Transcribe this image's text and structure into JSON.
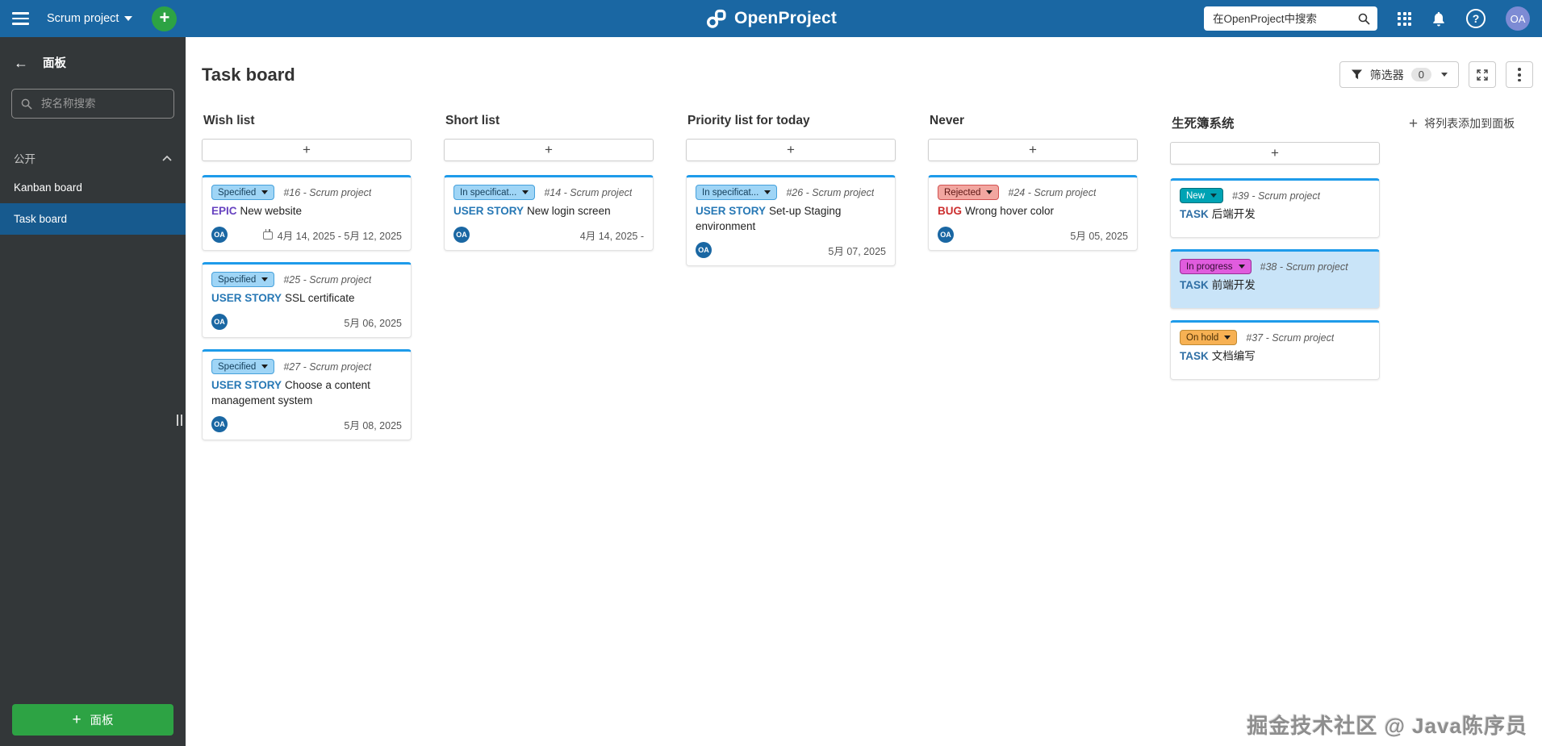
{
  "topbar": {
    "project_name": "Scrum project",
    "logo_text": "OpenProject",
    "search_placeholder": "在OpenProject中搜索",
    "avatar_initials": "OA"
  },
  "sidebar": {
    "title": "面板",
    "search_placeholder": "按名称搜索",
    "section_label": "公开",
    "items": [
      {
        "label": "Kanban board",
        "active": false
      },
      {
        "label": "Task board",
        "active": true
      }
    ],
    "new_board_label": "面板"
  },
  "main": {
    "title": "Task board",
    "filter_label": "筛选器",
    "filter_count": "0",
    "add_list_label": "将列表添加到面板",
    "board": {
      "add_card_label": "+",
      "status_styles": {
        "Specified": {
          "bg": "#9FD5F6",
          "border": "#46A1DB",
          "text": "#16405C"
        },
        "In specificat...": {
          "bg": "#9FD5F6",
          "border": "#46A1DB",
          "text": "#16405C"
        },
        "Rejected": {
          "bg": "#F2A6A0",
          "border": "#D25353",
          "text": "#5C1512"
        },
        "New": {
          "bg": "#00A3B4",
          "border": "#00707B",
          "text": "#FFFFFF"
        },
        "In progress": {
          "bg": "#E05CDE",
          "border": "#972F96",
          "text": "#330B33"
        },
        "On hold": {
          "bg": "#F7B153",
          "border": "#BF8A33",
          "text": "#4A2E05"
        }
      },
      "type_colors": {
        "EPIC": "#6742C0",
        "USER STORY": "#2778B5",
        "BUG": "#CC2E2E",
        "TASK": "#2F6FA5"
      },
      "columns": [
        {
          "title": "Wish list",
          "cards": [
            {
              "status": "Specified",
              "id": "#16",
              "project": "Scrum project",
              "type": "EPIC",
              "title": "New website",
              "avatar": "OA",
              "date": "4月 14, 2025 - 5月 12, 2025",
              "date_icon": true
            },
            {
              "status": "Specified",
              "id": "#25",
              "project": "Scrum project",
              "type": "USER STORY",
              "title": "SSL certificate",
              "avatar": "OA",
              "date": "5月 06, 2025"
            },
            {
              "status": "Specified",
              "id": "#27",
              "project": "Scrum project",
              "type": "USER STORY",
              "title": "Choose a content management system",
              "avatar": "OA",
              "date": "5月 08, 2025"
            }
          ]
        },
        {
          "title": "Short list",
          "cards": [
            {
              "status": "In specificat...",
              "id": "#14",
              "project": "Scrum project",
              "type": "USER STORY",
              "title": "New login screen",
              "avatar": "OA",
              "date": "4月 14, 2025 -"
            }
          ]
        },
        {
          "title": "Priority list for today",
          "cards": [
            {
              "status": "In specificat...",
              "id": "#26",
              "project": "Scrum project",
              "type": "USER STORY",
              "title": "Set-up Staging environment",
              "avatar": "OA",
              "date": "5月 07, 2025"
            }
          ]
        },
        {
          "title": "Never",
          "cards": [
            {
              "status": "Rejected",
              "id": "#24",
              "project": "Scrum project",
              "type": "BUG",
              "title": "Wrong hover color",
              "avatar": "OA",
              "date": "5月 05, 2025"
            }
          ]
        },
        {
          "title": "生死簿系统",
          "cards": [
            {
              "status": "New",
              "id": "#39",
              "project": "Scrum project",
              "type": "TASK",
              "title": "后端开发"
            },
            {
              "status": "In progress",
              "id": "#38",
              "project": "Scrum project",
              "type": "TASK",
              "title": "前端开发",
              "highlighted": true
            },
            {
              "status": "On hold",
              "id": "#37",
              "project": "Scrum project",
              "type": "TASK",
              "title": "文档编写"
            }
          ]
        }
      ]
    }
  },
  "watermark": "掘金技术社区 @ Java陈序员"
}
